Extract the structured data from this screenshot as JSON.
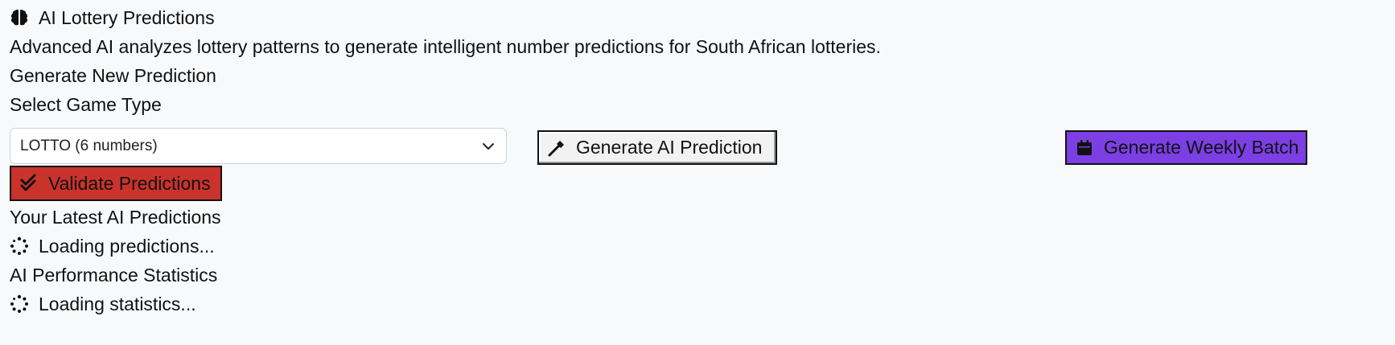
{
  "header": {
    "title": "AI Lottery Predictions",
    "description": "Advanced AI analyzes lottery patterns to generate intelligent number predictions for South African lotteries."
  },
  "generate": {
    "section_title": "Generate New Prediction",
    "select_label": "Select Game Type",
    "selected_game": "LOTTO (6 numbers)",
    "generate_button": "Generate AI Prediction",
    "weekly_button": "Generate Weekly Batch",
    "validate_button": "Validate Predictions"
  },
  "predictions": {
    "section_title": "Your Latest AI Predictions",
    "loading_text": "Loading predictions..."
  },
  "stats": {
    "section_title": "AI Performance Statistics",
    "loading_text": "Loading statistics..."
  },
  "colors": {
    "weekly_button": "#7b3fe4",
    "validate_button": "#c9332b",
    "generate_button": "#f2f2f2"
  },
  "icons": {
    "title": "brain-icon",
    "select": "chevron-down-icon",
    "generate": "magic-wand-icon",
    "weekly": "calendar-icon",
    "validate": "double-check-icon",
    "loading": "spinner-icon"
  }
}
